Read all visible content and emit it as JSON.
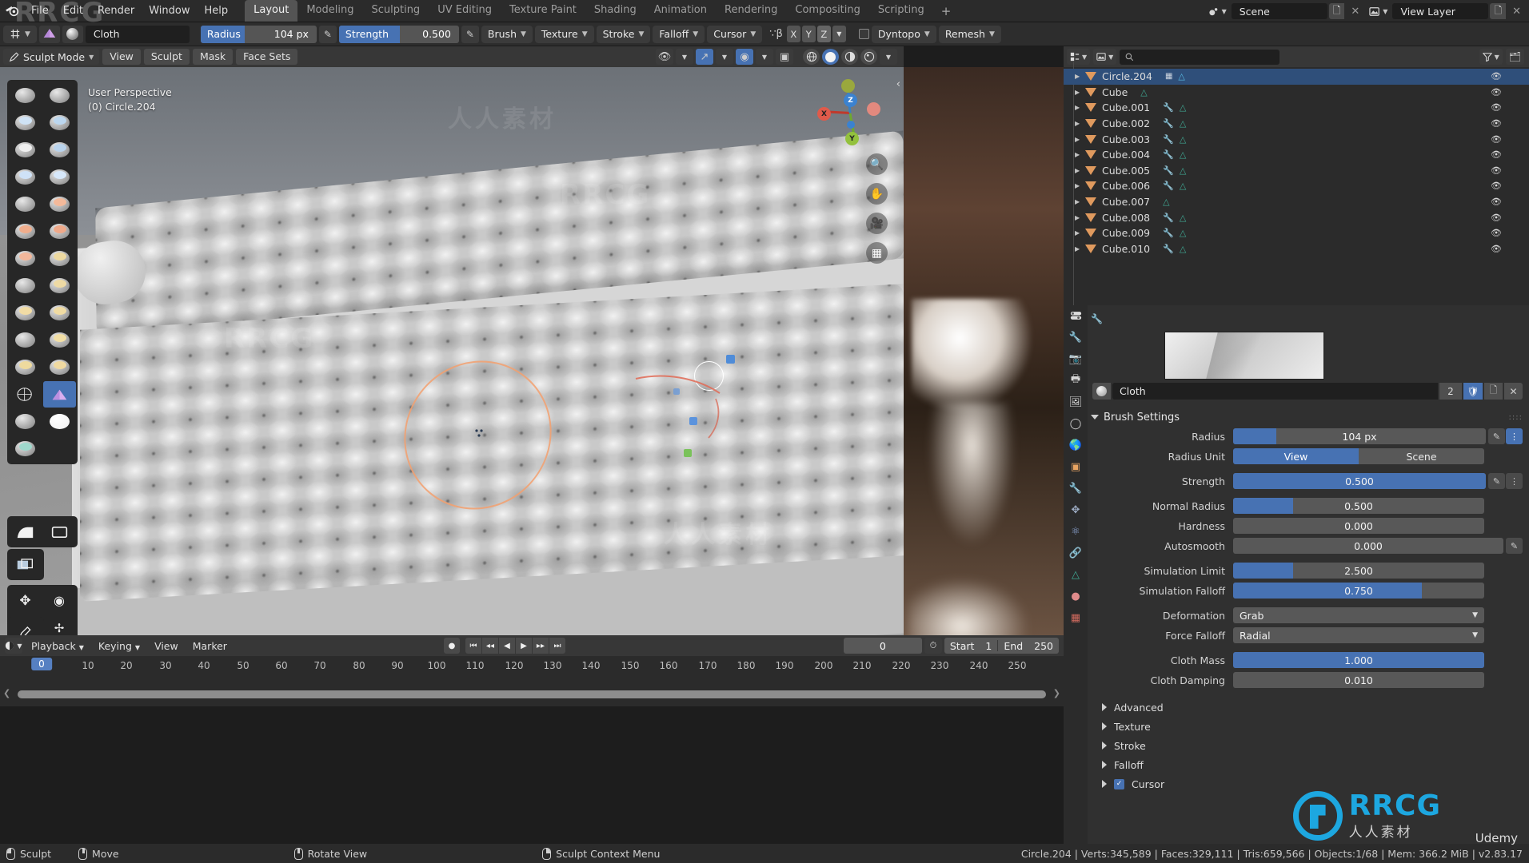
{
  "topbar": {
    "logo_icon": "blender-logo",
    "menus": [
      "File",
      "Edit",
      "Render",
      "Window",
      "Help"
    ],
    "workspaces": [
      "Layout",
      "Modeling",
      "Sculpting",
      "UV Editing",
      "Texture Paint",
      "Shading",
      "Animation",
      "Rendering",
      "Compositing",
      "Scripting"
    ],
    "active_workspace": "Layout",
    "add_workspace": "+",
    "scene_label": "Scene",
    "view_layer_label": "View Layer"
  },
  "toolheader": {
    "brush_name": "Cloth",
    "radius_label": "Radius",
    "radius_value": "104 px",
    "strength_label": "Strength",
    "strength_value": "0.500",
    "menus": [
      "Brush",
      "Texture",
      "Stroke",
      "Falloff",
      "Cursor"
    ],
    "symmetry_axes": [
      "X",
      "Y",
      "Z"
    ],
    "symmetry_active": [
      "Z"
    ],
    "dyntopo_label": "Dyntopo",
    "remesh_label": "Remesh"
  },
  "viewport_header": {
    "mode": "Sculpt Mode",
    "menus": [
      "View",
      "Sculpt",
      "Mask",
      "Face Sets"
    ]
  },
  "viewport": {
    "perspective_text": "User Perspective",
    "object_text": "(0) Circle.204",
    "gizmo_axes": [
      "X",
      "Y",
      "Z"
    ],
    "nav_icons": [
      "zoom-icon",
      "hand-icon",
      "camera-icon",
      "grid-icon"
    ]
  },
  "outliner": {
    "search_placeholder": "",
    "items": [
      {
        "name": "Circle.204",
        "selected": true,
        "wrench": false,
        "data": true,
        "extra": true
      },
      {
        "name": "Cube",
        "selected": false,
        "wrench": false,
        "data": true,
        "extra": false
      },
      {
        "name": "Cube.001",
        "selected": false,
        "wrench": true,
        "data": true,
        "extra": false
      },
      {
        "name": "Cube.002",
        "selected": false,
        "wrench": true,
        "data": true,
        "extra": false
      },
      {
        "name": "Cube.003",
        "selected": false,
        "wrench": true,
        "data": true,
        "extra": false
      },
      {
        "name": "Cube.004",
        "selected": false,
        "wrench": true,
        "data": true,
        "extra": false
      },
      {
        "name": "Cube.005",
        "selected": false,
        "wrench": true,
        "data": true,
        "extra": false
      },
      {
        "name": "Cube.006",
        "selected": false,
        "wrench": true,
        "data": true,
        "extra": false
      },
      {
        "name": "Cube.007",
        "selected": false,
        "wrench": false,
        "data": true,
        "extra": false
      },
      {
        "name": "Cube.008",
        "selected": false,
        "wrench": true,
        "data": true,
        "extra": false
      },
      {
        "name": "Cube.009",
        "selected": false,
        "wrench": true,
        "data": true,
        "extra": false
      },
      {
        "name": "Cube.010",
        "selected": false,
        "wrench": true,
        "data": true,
        "extra": false
      }
    ]
  },
  "properties": {
    "brush_name": "Cloth",
    "brush_users": "2",
    "panel_title": "Brush Settings",
    "rows": [
      {
        "label": "Radius",
        "value": "104 px",
        "fill": 0.17,
        "type": "slider",
        "icons": [
          "pressure-icon",
          "unified-icon"
        ]
      },
      {
        "label": "Radius Unit",
        "type": "segment",
        "options": [
          "View",
          "Scene"
        ],
        "active": "View"
      },
      {
        "label": "Strength",
        "value": "0.500",
        "fill": 1.0,
        "type": "slider",
        "icons": [
          "pressure-icon",
          "unified-icon"
        ]
      },
      {
        "label": "Normal Radius",
        "value": "0.500",
        "fill": 0.24,
        "type": "slider",
        "icons": []
      },
      {
        "label": "Hardness",
        "value": "0.000",
        "fill": 0.0,
        "type": "slider",
        "icons": []
      },
      {
        "label": "Autosmooth",
        "value": "0.000",
        "fill": 0.0,
        "type": "slider",
        "icons": [
          "pressure-icon"
        ]
      },
      {
        "label": "Simulation Limit",
        "value": "2.500",
        "fill": 0.24,
        "type": "slider",
        "icons": []
      },
      {
        "label": "Simulation Falloff",
        "value": "0.750",
        "fill": 0.75,
        "type": "slider",
        "icons": []
      },
      {
        "label": "Deformation",
        "value": "Grab",
        "type": "dropdown"
      },
      {
        "label": "Force Falloff",
        "value": "Radial",
        "type": "dropdown"
      },
      {
        "label": "Cloth Mass",
        "value": "1.000",
        "fill": 1.0,
        "type": "slider",
        "icons": []
      },
      {
        "label": "Cloth Damping",
        "value": "0.010",
        "fill": 0.0,
        "type": "slider",
        "icons": []
      }
    ],
    "subpanels": [
      "Advanced",
      "Texture",
      "Stroke",
      "Falloff"
    ],
    "cursor_panel": "Cursor",
    "cursor_checked": true
  },
  "timeline": {
    "menus": [
      "Playback",
      "Keying",
      "View",
      "Marker"
    ],
    "playback_icons": [
      "record-icon",
      "jump-start-icon",
      "prev-keyframe-icon",
      "play-reverse-icon",
      "play-icon",
      "next-keyframe-icon",
      "jump-end-icon"
    ],
    "current_frame": "0",
    "start_label": "Start",
    "start_value": "1",
    "end_label": "End",
    "end_value": "250",
    "ticks": [
      "0",
      "10",
      "20",
      "30",
      "40",
      "50",
      "60",
      "70",
      "80",
      "90",
      "100",
      "110",
      "120",
      "130",
      "140",
      "150",
      "160",
      "170",
      "180",
      "190",
      "200",
      "210",
      "220",
      "230",
      "240",
      "250"
    ],
    "playhead_frame": "0"
  },
  "statusbar": {
    "items": [
      {
        "icon": "mouse-left-icon",
        "label": "Sculpt"
      },
      {
        "icon": "mouse-middle-icon",
        "label": "Move"
      },
      {
        "icon": "mouse-middle-icon",
        "label": "Rotate View"
      },
      {
        "icon": "mouse-right-icon",
        "label": "Sculpt Context Menu"
      }
    ],
    "stats": "Circle.204 | Verts:345,589 | Faces:329,111 | Tris:659,566 | Objects:1/68 | Mem: 366.2 MiB | v2.83.17"
  },
  "watermark": {
    "brand": "RRCG",
    "brand_cn": "人人素材",
    "udemy": "Udemy"
  },
  "colors": {
    "accent_blue": "#4772b3",
    "select_orange": "#e09a5e",
    "mesh_teal": "#3fa893",
    "wrench_blue": "#7fa7d8",
    "bg_dark": "#2b2b2b",
    "panel_bg": "#303030"
  }
}
